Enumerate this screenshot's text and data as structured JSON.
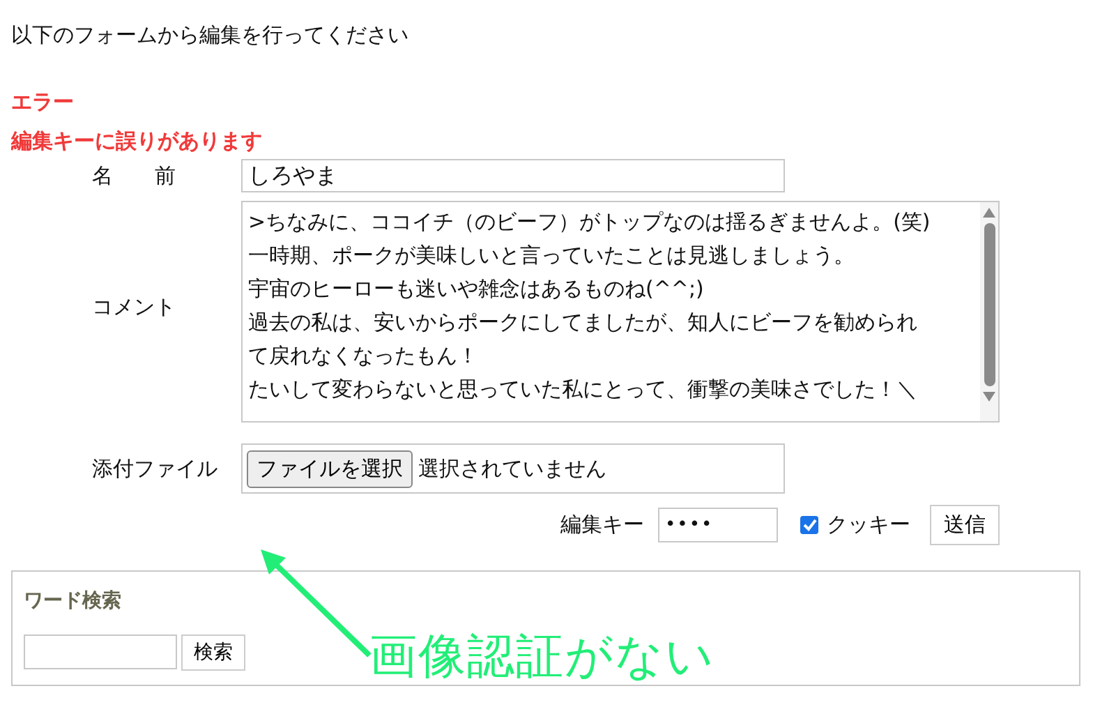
{
  "intro": "以下のフォームから編集を行ってください",
  "errors": {
    "title": "エラー",
    "message": "編集キーに誤りがあります"
  },
  "form": {
    "name": {
      "label": "名　　前",
      "value": "しろやま"
    },
    "comment": {
      "label": "コメント",
      "lines": [
        ">ちなみに、ココイチ（のビーフ）がトップなのは揺るぎませんよ。(笑)",
        "一時期、ポークが美味しいと言っていたことは見逃しましょう。",
        "宇宙のヒーローも迷いや雑念はあるものね(^^;)",
        "過去の私は、安いからポークにしてましたが、知人にビーフを勧められ",
        "て戻れなくなったもん！",
        "たいして変わらないと思っていた私にとって、衝撃の美味さでした！＼"
      ]
    },
    "attachment": {
      "label": "添付ファイル",
      "button": "ファイルを選択",
      "status": "選択されていません"
    },
    "edit_key": {
      "label": "編集キー",
      "value": "••••"
    },
    "cookie": {
      "label": "クッキー",
      "checked": true
    },
    "submit": "送信"
  },
  "search": {
    "title": "ワード検索",
    "button": "検索"
  },
  "annotation": {
    "text": "画像認証がない"
  }
}
